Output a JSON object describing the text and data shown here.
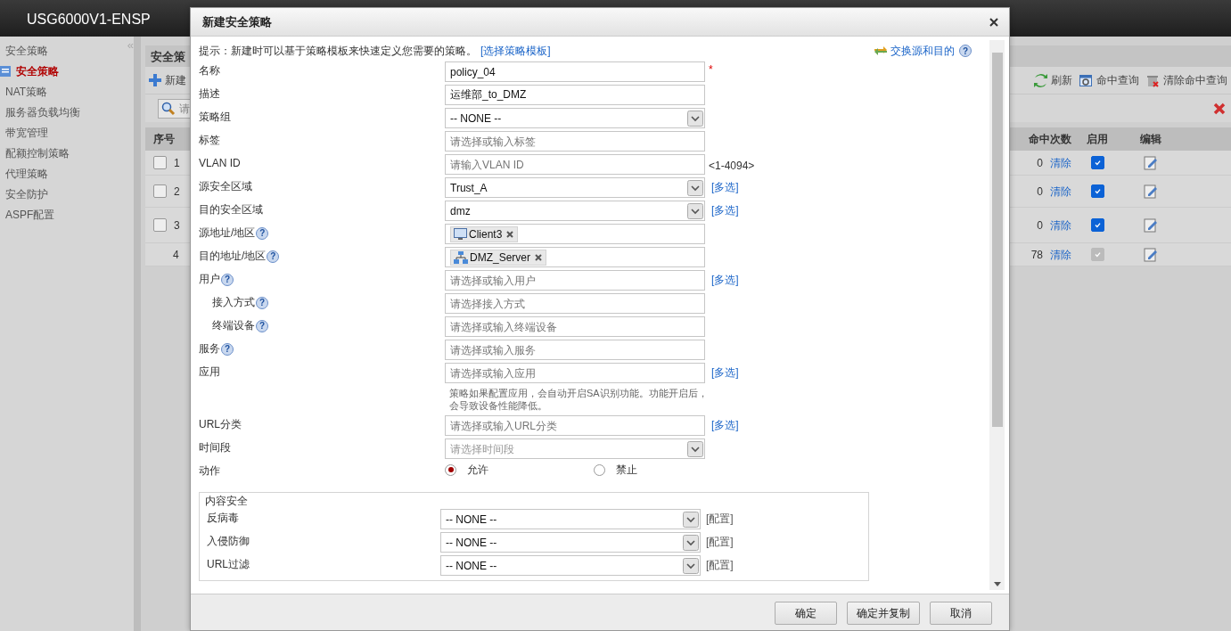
{
  "app": {
    "title": "USG6000V1-ENSP"
  },
  "sidebar": {
    "collapse": "«",
    "items": [
      {
        "label": "安全策略",
        "selected": false
      },
      {
        "label": "安全策略",
        "selected": true
      },
      {
        "label": "NAT策略",
        "selected": false
      },
      {
        "label": "服务器负载均衡",
        "selected": false
      },
      {
        "label": "带宽管理",
        "selected": false
      },
      {
        "label": "配额控制策略",
        "selected": false
      },
      {
        "label": "代理策略",
        "selected": false
      },
      {
        "label": "安全防护",
        "selected": false
      },
      {
        "label": "ASPF配置",
        "selected": false
      }
    ]
  },
  "panel": {
    "title": "安全策",
    "new_button": "新建",
    "search_placeholder": "请",
    "toolbar": [
      {
        "kind": "refresh",
        "label": "刷新"
      },
      {
        "kind": "query",
        "label": "命中查询"
      },
      {
        "kind": "clear",
        "label": "清除命中查询"
      }
    ],
    "columns": {
      "number": "序号",
      "hits": "命中次数",
      "enabled": "启用",
      "edit": "编辑"
    },
    "rows": [
      {
        "kind": "policy",
        "selected": false,
        "number": "1",
        "hits": "0",
        "clear": "清除",
        "enabled": true
      },
      {
        "kind": "policy",
        "selected": false,
        "number": "2",
        "hits": "0",
        "clear": "清除",
        "enabled": true
      },
      {
        "kind": "policy",
        "selected": false,
        "number": "3",
        "hits": "0",
        "clear": "清除",
        "enabled": true
      },
      {
        "kind": "default",
        "number": "4",
        "hits": "78",
        "clear": "清除",
        "enabled": true
      }
    ]
  },
  "dialog": {
    "title": "新建安全策略",
    "hint": "提示：新建时可以基于策略模板来快速定义您需要的策略。",
    "hint_link": "[选择策略模板]",
    "swap": "交换源和目的",
    "swap_help": "?",
    "fields": [
      {
        "kind": "text",
        "label": "名称",
        "value": "policy_04",
        "required": "*"
      },
      {
        "kind": "text",
        "label": "描述",
        "value": "运维部_to_DMZ"
      },
      {
        "kind": "select",
        "label": "策略组",
        "value": "-- NONE --"
      },
      {
        "kind": "text",
        "label": "标签",
        "placeholder": "请选择或输入标签"
      },
      {
        "kind": "text",
        "label": "VLAN ID",
        "placeholder": "请输入VLAN ID",
        "suffix": "<1-4094>"
      },
      {
        "kind": "select",
        "label": "源安全区域",
        "value": "Trust_A",
        "link": "[多选]"
      },
      {
        "kind": "select",
        "label": "目的安全区域",
        "value": "dmz",
        "link": "[多选]"
      },
      {
        "kind": "tags",
        "label": "源地址/地区",
        "help": "?",
        "tags": [
          {
            "kind": "host",
            "label": "Client3"
          }
        ]
      },
      {
        "kind": "tags",
        "label": "目的地址/地区",
        "help": "?",
        "tags": [
          {
            "kind": "network",
            "label": "DMZ_Server"
          }
        ]
      },
      {
        "kind": "text",
        "label": "用户",
        "help": "?",
        "placeholder": "请选择或输入用户",
        "link": "[多选]",
        "children": [
          {
            "kind": "text",
            "label": "接入方式",
            "help": "?",
            "placeholder": "请选择接入方式"
          },
          {
            "kind": "text",
            "label": "终端设备",
            "help": "?",
            "placeholder": "请选择或输入终端设备"
          }
        ]
      },
      {
        "kind": "text",
        "label": "服务",
        "help": "?",
        "placeholder": "请选择或输入服务"
      },
      {
        "kind": "text",
        "label": "应用",
        "placeholder": "请选择或输入应用",
        "link": "[多选]",
        "note": "策略如果配置应用，会自动开启SA识别功能。功能开启后，会导致设备性能降低。"
      },
      {
        "kind": "text",
        "label": "URL分类",
        "placeholder": "请选择或输入URL分类",
        "link": "[多选]"
      },
      {
        "kind": "select",
        "label": "时间段",
        "placeholder": "请选择时间段"
      },
      {
        "kind": "radio",
        "label": "动作",
        "options": [
          {
            "label": "允许",
            "selected": true
          },
          {
            "label": "禁止",
            "selected": false
          }
        ]
      }
    ],
    "content_security": {
      "title": "内容安全",
      "rows": [
        {
          "label": "反病毒",
          "value": "-- NONE --",
          "link": "[配置]"
        },
        {
          "label": "入侵防御",
          "value": "-- NONE --",
          "link": "[配置]"
        },
        {
          "label": "URL过滤",
          "value": "-- NONE --",
          "link": "[配置]"
        }
      ]
    },
    "buttons": [
      "确定",
      "确定并复制",
      "取消"
    ]
  }
}
